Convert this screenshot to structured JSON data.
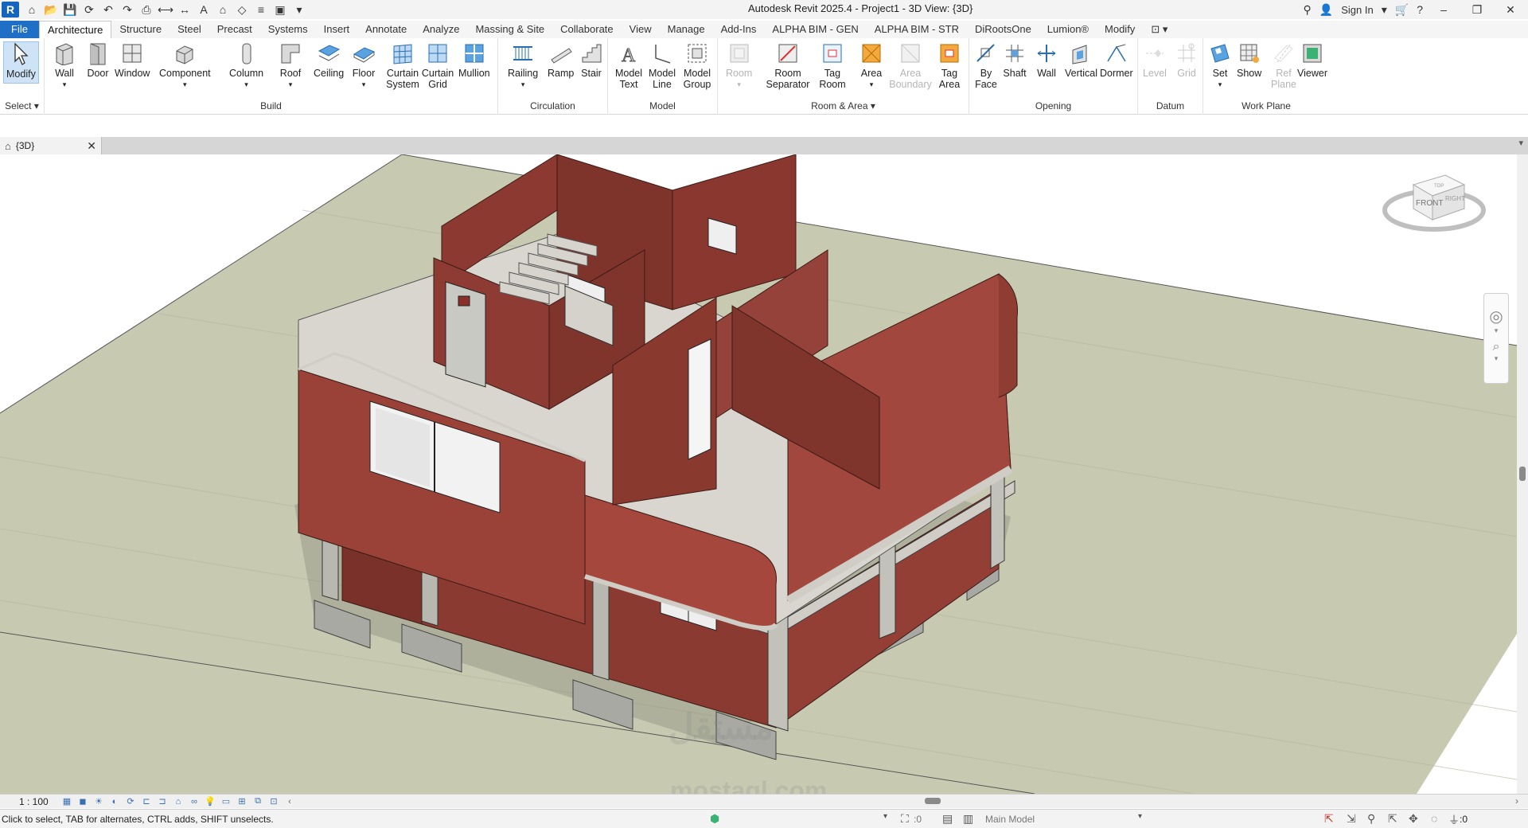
{
  "window": {
    "title": "Autodesk Revit 2025.4 - Project1 - 3D View: {3D}",
    "app_letter": "R",
    "sign_in": "Sign In"
  },
  "menu_tabs": [
    "File",
    "Architecture",
    "Structure",
    "Steel",
    "Precast",
    "Systems",
    "Insert",
    "Annotate",
    "Analyze",
    "Massing & Site",
    "Collaborate",
    "View",
    "Manage",
    "Add-Ins",
    "ALPHA BIM - GEN",
    "ALPHA BIM - STR",
    "DiRootsOne",
    "Lumion®",
    "Modify"
  ],
  "active_tab": "Architecture",
  "ribbon": {
    "select": {
      "button": "Modify",
      "label": "Select"
    },
    "build": {
      "label": "Build",
      "buttons": [
        "Wall",
        "Door",
        "Window",
        "Component",
        "Column",
        "Roof",
        "Ceiling",
        "Floor",
        "Curtain System",
        "Curtain Grid",
        "Mullion"
      ]
    },
    "circulation": {
      "label": "Circulation",
      "buttons": [
        "Railing",
        "Ramp",
        "Stair"
      ]
    },
    "model": {
      "label": "Model",
      "buttons": [
        "Model Text",
        "Model Line",
        "Model Group"
      ]
    },
    "room_area": {
      "label": "Room & Area",
      "buttons": [
        "Room",
        "Room Separator",
        "Tag Room",
        "Area",
        "Area Boundary",
        "Tag Area"
      ]
    },
    "opening": {
      "label": "Opening",
      "buttons": [
        "By Face",
        "Shaft",
        "Wall",
        "Vertical",
        "Dormer"
      ]
    },
    "datum": {
      "label": "Datum",
      "buttons": [
        "Level",
        "Grid"
      ]
    },
    "work_plane": {
      "label": "Work Plane",
      "buttons": [
        "Set",
        "Show",
        "Ref Plane",
        "Viewer"
      ]
    }
  },
  "document_tab": {
    "name": "{3D}"
  },
  "view_bar": {
    "scale": "1 : 100"
  },
  "status": {
    "message": "Click to select, TAB for alternates, CTRL adds, SHIFT unselects.",
    "worksets_count": ":0",
    "active_model": "Main Model",
    "filter_count": ":0"
  },
  "viewcube": {
    "front": "FRONT",
    "right": "RIGHT",
    "top": "TOP"
  },
  "watermark": {
    "arabic": "مستقل",
    "latin": "mostaql.com"
  },
  "colors": {
    "file_tab": "#1e6fc5",
    "brick": "#9b4238",
    "slab": "#d8d6cf",
    "ground": "#c8c9b1"
  }
}
